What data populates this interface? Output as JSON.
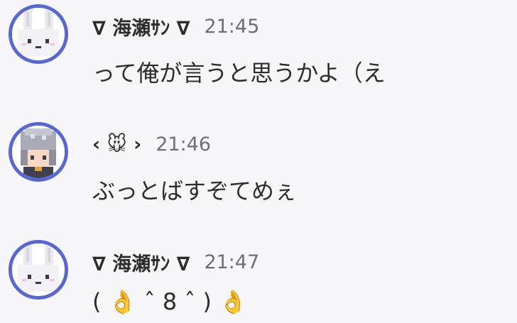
{
  "messages": [
    {
      "username": "∇ 海瀬ｻﾝ ∇",
      "timestamp": "21:45",
      "content": "って俺が言うと思うかよ（え",
      "avatar_icon": "bunny-avatar-icon"
    },
    {
      "username": "‹ 🐭 ›",
      "timestamp": "21:46",
      "content": "ぶっとばすぞてめぇ",
      "avatar_icon": "silver-hair-character-avatar-icon"
    },
    {
      "username": "∇ 海瀬ｻﾝ ∇",
      "timestamp": "21:47",
      "content": "( 👌 ˆ 8 ˆ ) 👌",
      "avatar_icon": "bunny-avatar-icon"
    }
  ],
  "colors": {
    "background": "#f7f6fa",
    "avatar_ring": "#5867d6",
    "username": "#2b2d31",
    "timestamp": "#6d6f78"
  }
}
